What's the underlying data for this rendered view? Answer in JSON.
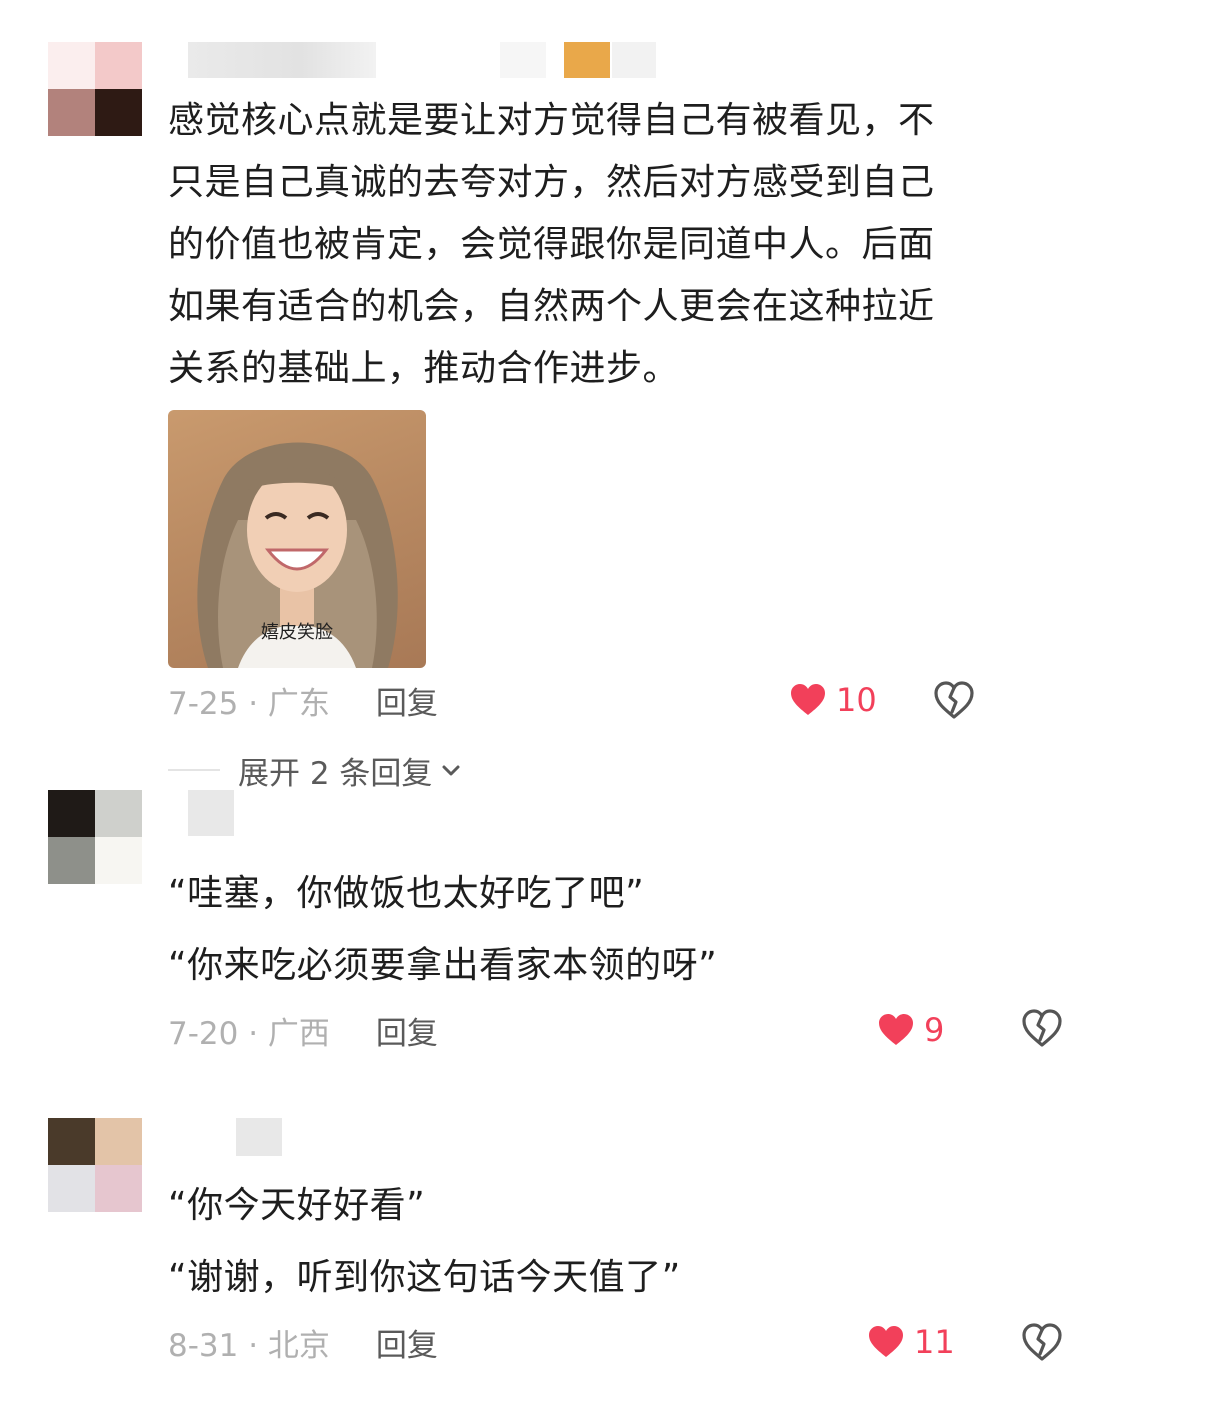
{
  "comments": [
    {
      "text_lines": [
        "感觉核心点就是要让对方觉得自己有被看见，不",
        "只是自己真诚的去夸对方，然后对方感受到自己",
        "的价值也被肯定，会觉得跟你是同道中人。后面",
        "如果有适合的机会，自然两个人更会在这种拉近",
        "关系的基础上，推动合作进步。"
      ],
      "sticker_caption": "嬉皮笑脸",
      "date_location": "7-25 · 广东",
      "reply_label": "回复",
      "like_count": "10",
      "expand_label": "展开 2 条回复"
    },
    {
      "text_lines": [
        "“哇塞，你做饭也太好吃了吧”",
        "“你来吃必须要拿出看家本领的呀”"
      ],
      "date_location": "7-20 · 广西",
      "reply_label": "回复",
      "like_count": "9"
    },
    {
      "text_lines": [
        "“你今天好好看”",
        "“谢谢，听到你这句话今天值了”"
      ],
      "date_location": "8-31 · 北京",
      "reply_label": "回复",
      "like_count": "11"
    }
  ],
  "icons": {
    "like": "heart-icon",
    "dislike": "broken-heart-icon",
    "expand": "chevron-down-icon"
  },
  "colors": {
    "like_red": "#f2405a",
    "date_gray": "#b0b0b0",
    "reply_gray": "#5a5a5a"
  }
}
